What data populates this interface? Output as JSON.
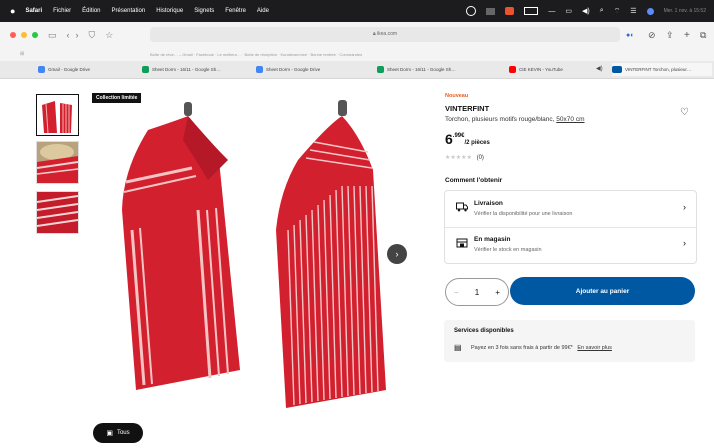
{
  "menubar": {
    "app": "Safari",
    "items": [
      "Fichier",
      "Édition",
      "Présentation",
      "Historique",
      "Signets",
      "Fenêtre",
      "Aide"
    ],
    "clock": "Mer. 1 nov. à 15:52"
  },
  "browser": {
    "url": "ikea.com",
    "favorites": "Boîte de réce… – Gmail · Facebook · Le meilleur… · Boîte de réception · Kundenservice · Bonne rentrée · Commandes",
    "tabs": [
      {
        "label": "Gmail - Google Drive",
        "color": "#4285f4"
      },
      {
        "label": "Sheet Dorm - 16/11 - Google Sh…",
        "color": "#0f9d58"
      },
      {
        "label": "Sheet Dorm - Google Drive",
        "color": "#4285f4"
      },
      {
        "label": "Sheet Dorm - 16/11 - Google Sh…",
        "color": "#0f9d58"
      },
      {
        "label": "CIE KEVIN - YouTube",
        "color": "#ff0000"
      },
      {
        "label": "VINTERFINT Torchon, plusieur…",
        "color": "#0058a3"
      }
    ]
  },
  "gallery": {
    "badge": "Collection limitée",
    "all_button": "Tous"
  },
  "product": {
    "new_label": "Nouveau",
    "name": "VINTERFINT",
    "description": "Torchon, plusieurs motifs rouge/blanc,",
    "dimensions": "50x70 cm",
    "price_int": "6",
    "price_dec": ".99€",
    "price_unit": "/2 pièces",
    "reviews": "(0)",
    "rating": 0
  },
  "delivery": {
    "heading": "Comment l'obtenir",
    "options": [
      {
        "title": "Livraison",
        "subtitle": "Vérifier la disponibilité pour une livraison"
      },
      {
        "title": "En magasin",
        "subtitle": "Vérifier le stock en magasin"
      }
    ]
  },
  "purchase": {
    "quantity": "1",
    "minus": "−",
    "plus": "+",
    "add_to_cart": "Ajouter au panier"
  },
  "services": {
    "heading": "Services disponibles",
    "text": "Payez en 3 fois sans frais à partir de 99€*",
    "link": "En savoir plus"
  },
  "colors": {
    "accent": "#0058a3",
    "new": "#e85d24",
    "towel": "#d2202f"
  }
}
